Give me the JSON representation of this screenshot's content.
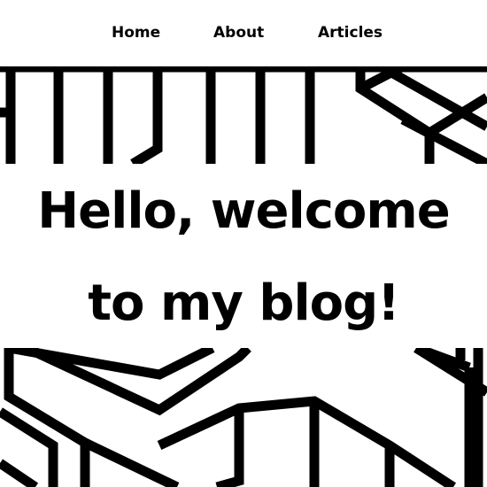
{
  "nav": {
    "items": [
      {
        "label": "Home"
      },
      {
        "label": "About"
      },
      {
        "label": "Articles"
      }
    ]
  },
  "hero": {
    "line1": "Hello, welcome",
    "line2": "to my blog!"
  },
  "colors": {
    "background": "#ffffff",
    "text": "#000000",
    "pattern": "#000000"
  },
  "decoration": {
    "pattern_name": "geometric-line-pattern"
  }
}
